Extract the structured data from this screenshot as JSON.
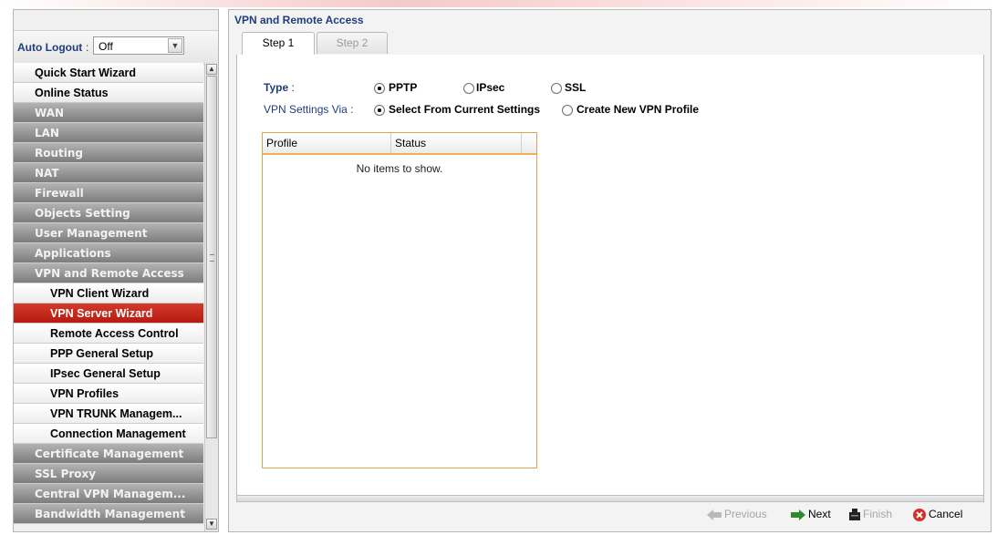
{
  "sidebar": {
    "auto_logout_label": "Auto Logout",
    "auto_logout_colon": ":",
    "auto_logout_value": "Off",
    "menu": [
      {
        "label": "Quick Start Wizard",
        "style": "light"
      },
      {
        "label": "Online Status",
        "style": "light"
      },
      {
        "label": "WAN",
        "style": "dark"
      },
      {
        "label": "LAN",
        "style": "dark"
      },
      {
        "label": "Routing",
        "style": "dark"
      },
      {
        "label": "NAT",
        "style": "dark"
      },
      {
        "label": "Firewall",
        "style": "dark"
      },
      {
        "label": "Objects Setting",
        "style": "dark"
      },
      {
        "label": "User Management",
        "style": "dark"
      },
      {
        "label": "Applications",
        "style": "dark"
      },
      {
        "label": "VPN and Remote Access",
        "style": "dark"
      },
      {
        "label": "VPN Client Wizard",
        "style": "sub"
      },
      {
        "label": "VPN Server Wizard",
        "style": "active"
      },
      {
        "label": "Remote Access Control",
        "style": "sub"
      },
      {
        "label": "PPP General Setup",
        "style": "sub"
      },
      {
        "label": "IPsec General Setup",
        "style": "sub"
      },
      {
        "label": "VPN Profiles",
        "style": "sub"
      },
      {
        "label": "VPN TRUNK Managem...",
        "style": "sub"
      },
      {
        "label": "Connection Management",
        "style": "sub"
      },
      {
        "label": "Certificate Management",
        "style": "dark"
      },
      {
        "label": "SSL Proxy",
        "style": "dark"
      },
      {
        "label": "Central VPN Managem...",
        "style": "dark"
      },
      {
        "label": "Bandwidth Management",
        "style": "dark"
      }
    ]
  },
  "panel": {
    "title": "VPN and Remote Access",
    "tabs": [
      {
        "label": "Step 1",
        "active": true
      },
      {
        "label": "Step 2",
        "active": false
      }
    ],
    "type_label": "Type",
    "type_colon": ":",
    "type_options": [
      {
        "label": "PPTP",
        "checked": true
      },
      {
        "label": "IPsec",
        "checked": false
      },
      {
        "label": "SSL",
        "checked": false
      }
    ],
    "via_label": "VPN Settings Via :",
    "via_options": [
      {
        "label": "Select From Current Settings",
        "checked": true
      },
      {
        "label": "Create New VPN Profile",
        "checked": false
      }
    ],
    "grid": {
      "columns": [
        "Profile",
        "Status"
      ],
      "empty_message": "No items to show."
    },
    "footer": {
      "previous": "Previous",
      "next": "Next",
      "finish": "Finish",
      "cancel": "Cancel"
    }
  },
  "colors": {
    "accent_red": "#c0281a",
    "label_blue": "#1f3e7a",
    "grid_border": "#e0a24f"
  },
  "icons": {
    "previous": "arrow-left-icon",
    "next": "arrow-right-icon",
    "finish": "finish-icon",
    "cancel": "cancel-icon"
  }
}
